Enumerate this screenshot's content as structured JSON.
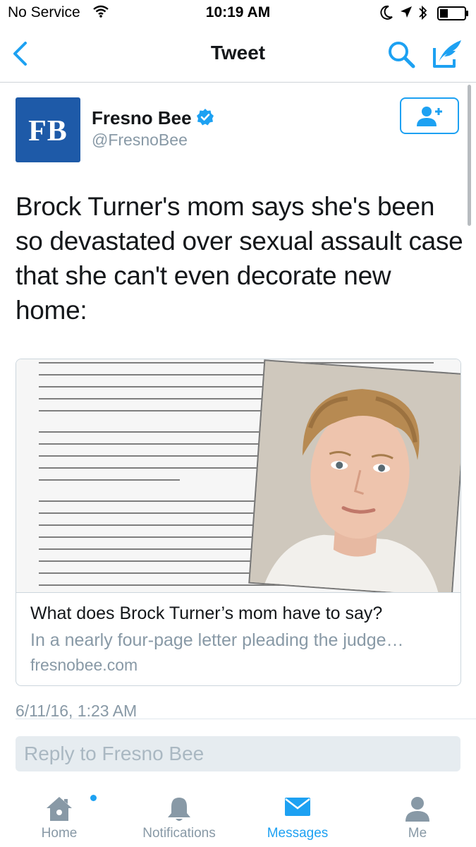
{
  "status_bar": {
    "carrier": "No Service",
    "time": "10:19 AM"
  },
  "nav": {
    "title": "Tweet"
  },
  "tweet": {
    "author_name": "Fresno Bee",
    "author_handle": "@FresnoBee",
    "avatar_initials": "FB",
    "text": "Brock Turner's mom says she's been so devastated over sexual assault case that she can't even decorate new home:",
    "timestamp": "6/11/16, 1:23 AM"
  },
  "link_card": {
    "title": "What does Brock Turner’s mom have to say?",
    "description": "In a nearly four-page letter pleading the judge…",
    "domain": "fresnobee.com"
  },
  "reply": {
    "placeholder": "Reply to Fresno Bee"
  },
  "tab_bar": {
    "items": [
      {
        "label": "Home",
        "icon": "home-icon"
      },
      {
        "label": "Notifications",
        "icon": "bell-icon"
      },
      {
        "label": "Messages",
        "icon": "envelope-icon"
      },
      {
        "label": "Me",
        "icon": "person-icon"
      }
    ],
    "active": "Messages"
  },
  "colors": {
    "accent": "#1da1f2",
    "avatar_bg": "#1e5aa8",
    "muted_text": "#8899a6"
  }
}
